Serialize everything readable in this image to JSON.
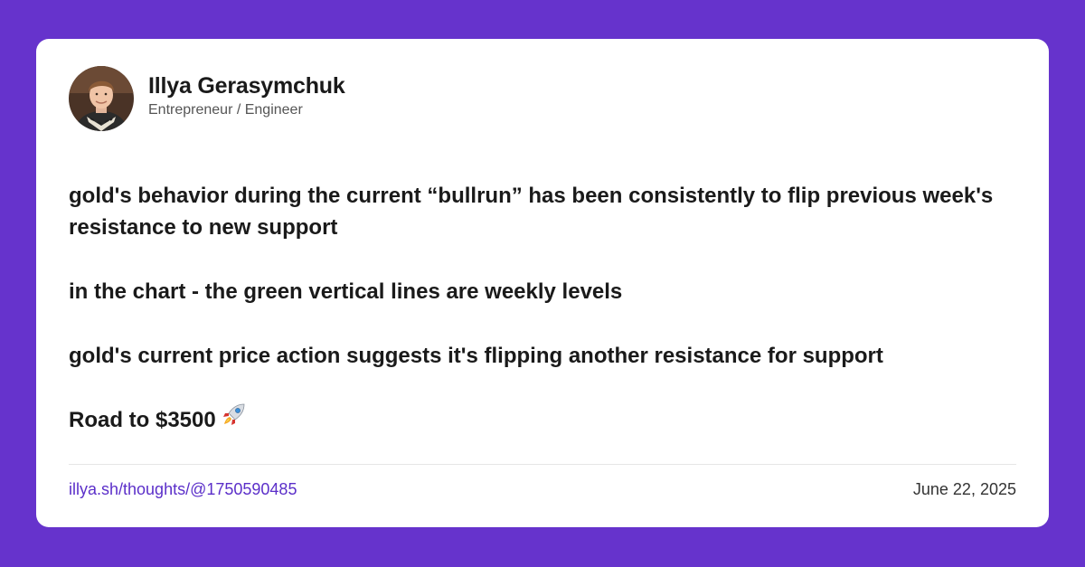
{
  "author": {
    "name": "Illya Gerasymchuk",
    "title": "Entrepreneur / Engineer",
    "avatar_icon": "avatar-portrait"
  },
  "post": {
    "paragraphs": [
      "gold's behavior during the current “bullrun” has been consistently to flip previous week's resistance to new support",
      "in the chart - the green vertical lines are weekly levels",
      "gold's current price action suggests it's flipping another resistance for support",
      "Road to $3500"
    ],
    "trailing_emoji": "rocket-icon"
  },
  "footer": {
    "link_text": "illya.sh/thoughts/@1750590485",
    "date": "June 22, 2025"
  },
  "colors": {
    "background": "#6633cc",
    "card": "#ffffff",
    "link": "#5b2fc9"
  }
}
